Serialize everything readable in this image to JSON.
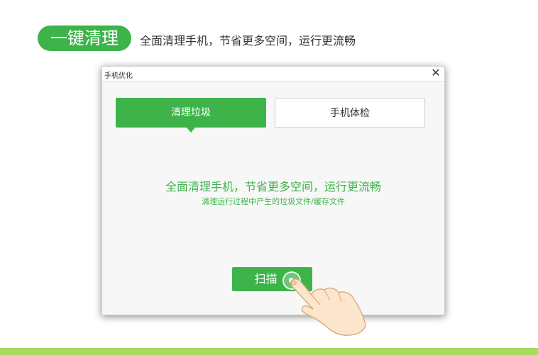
{
  "banner": {
    "badge": "一键清理",
    "caption": "全面清理手机，节省更多空间，运行更流畅"
  },
  "dialog": {
    "title": "手机优化",
    "close_glyph": "✕",
    "tabs": [
      {
        "label": "清理垃圾",
        "active": true
      },
      {
        "label": "手机体检",
        "active": false
      }
    ],
    "headline": "全面清理手机，节省更多空间，运行更流畅",
    "subline": "清理运行过程中产生的垃圾文件/缓存文件",
    "scan_label": "扫描"
  },
  "colors": {
    "accent": "#3db34a",
    "bottom_bar": "#a8dc5f",
    "dialog_bg": "#f7f7f7"
  },
  "icons": {
    "close": "close-icon",
    "hand": "pointing-hand-icon",
    "tap": "tap-ripple-icon"
  }
}
